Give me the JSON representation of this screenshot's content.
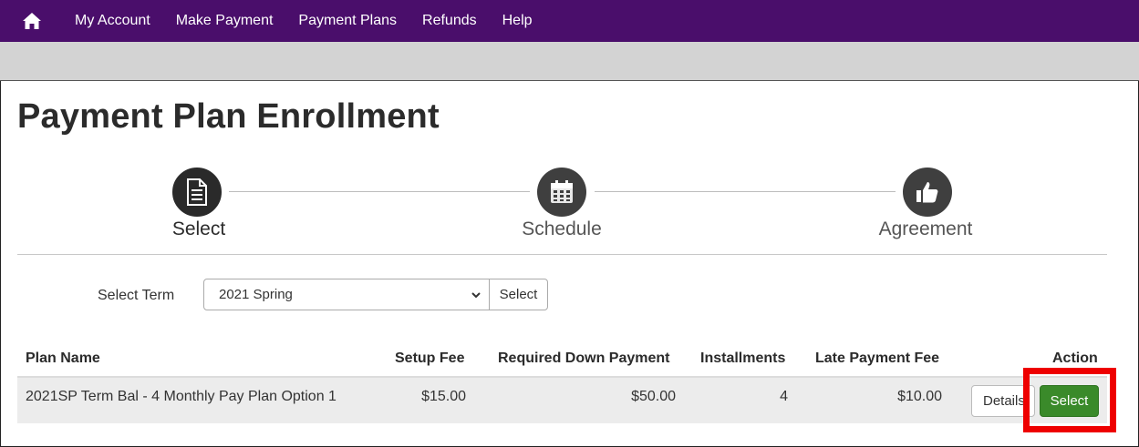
{
  "nav": {
    "home_icon": "home-icon",
    "items": [
      {
        "label": "My Account"
      },
      {
        "label": "Make Payment"
      },
      {
        "label": "Payment Plans"
      },
      {
        "label": "Refunds"
      },
      {
        "label": "Help"
      }
    ]
  },
  "page": {
    "title": "Payment Plan Enrollment"
  },
  "stepper": {
    "steps": [
      {
        "label": "Select",
        "icon": "document-icon",
        "state": "active"
      },
      {
        "label": "Schedule",
        "icon": "calendar-icon",
        "state": "inactive"
      },
      {
        "label": "Agreement",
        "icon": "thumbs-up-icon",
        "state": "inactive"
      }
    ]
  },
  "term": {
    "label": "Select Term",
    "selected": "2021 Spring",
    "button_label": "Select"
  },
  "table": {
    "headers": [
      "Plan Name",
      "Setup Fee",
      "Required Down Payment",
      "Installments",
      "Late Payment Fee",
      "Action"
    ],
    "rows": [
      {
        "plan_name": "2021SP Term Bal - 4 Monthly Pay Plan Option 1",
        "setup_fee": "$15.00",
        "down_payment": "$50.00",
        "installments": "4",
        "late_fee": "$10.00",
        "details_label": "Details",
        "select_label": "Select"
      }
    ]
  },
  "colors": {
    "nav_bg": "#4a0e6b",
    "select_button": "#3a8a2a",
    "highlight": "#ee0000"
  }
}
